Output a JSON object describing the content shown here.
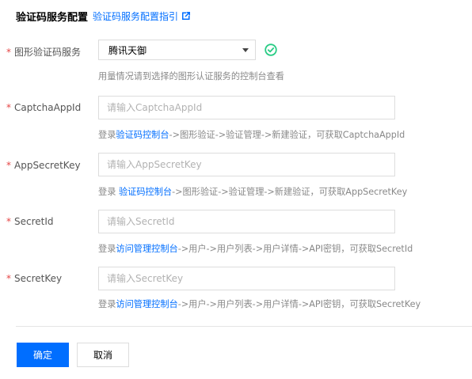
{
  "header": {
    "title": "验证码服务配置",
    "guide_link": "验证码服务配置指引"
  },
  "fields": {
    "provider": {
      "label": "图形验证码服务",
      "value": "腾讯天御",
      "help": "用量情况请到选择的图形认证服务的控制台查看"
    },
    "captcha_app_id": {
      "label": "CaptchaAppId",
      "placeholder": "请输入CaptchaAppId",
      "help_prefix": "登录",
      "help_link": "验证码控制台",
      "help_suffix": "->图形验证->验证管理->新建验证，可获取CaptchaAppId"
    },
    "app_secret_key": {
      "label": "AppSecretKey",
      "placeholder": "请输入AppSecretKey",
      "help_prefix": "登录 ",
      "help_link": "验证码控制台",
      "help_suffix": "->图形验证->验证管理->新建验证，可获取AppSecretKey"
    },
    "secret_id": {
      "label": "SecretId",
      "placeholder": "请输入SecretId",
      "help_prefix": "登录",
      "help_link": "访问管理控制台",
      "help_suffix": "->用户->用户列表->用户详情->API密钥，可获取SecretId"
    },
    "secret_key": {
      "label": "SecretKey",
      "placeholder": "请输入SecretKey",
      "help_prefix": "登录",
      "help_link": "访问管理控制台",
      "help_suffix": "->用户->用户列表->用户详情->API密钥，可获取SecretKey"
    }
  },
  "required_mark": "*",
  "actions": {
    "confirm": "确定",
    "cancel": "取消"
  },
  "colors": {
    "accent": "#006eff",
    "success": "#29cc85",
    "required": "#e54545"
  },
  "icons": {
    "external_link": "external-link-icon",
    "status": "check-circle-icon",
    "dropdown": "chevron-down-icon"
  }
}
